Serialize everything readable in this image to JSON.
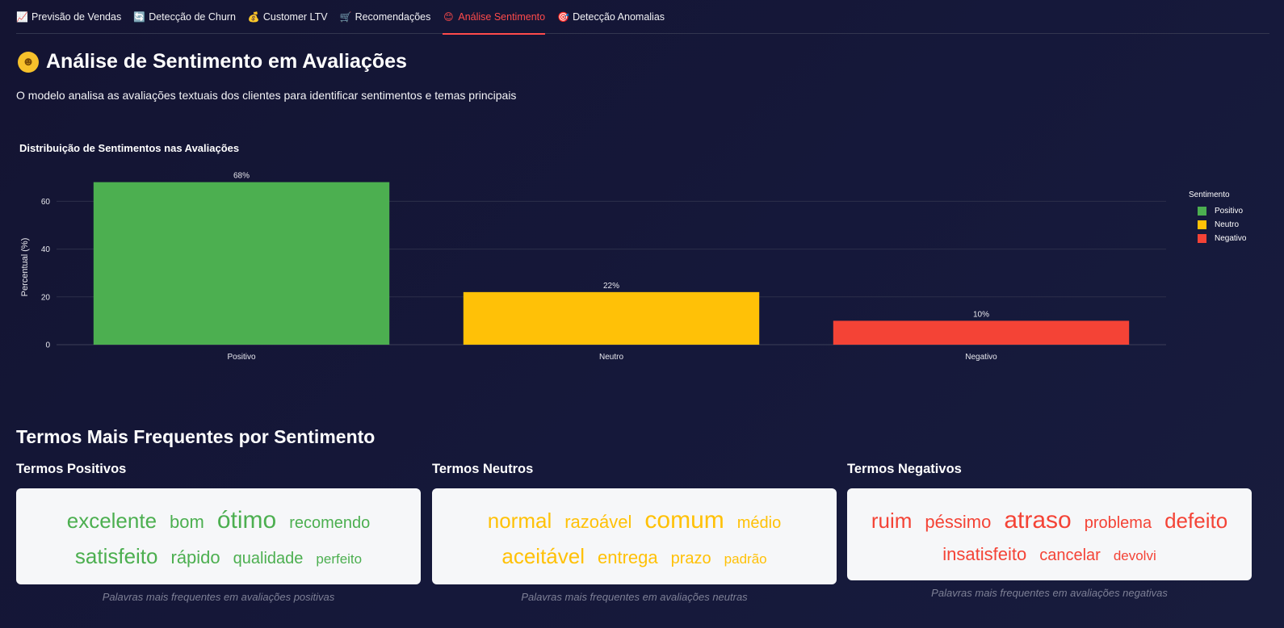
{
  "tabs": [
    {
      "icon": "📈",
      "label": "Previsão de Vendas",
      "active": false
    },
    {
      "icon": "🔄",
      "label": "Detecção de Churn",
      "active": false
    },
    {
      "icon": "💰",
      "label": "Customer LTV",
      "active": false
    },
    {
      "icon": "🛒",
      "label": "Recomendações",
      "active": false
    },
    {
      "icon": "😊",
      "label": "Análise Sentimento",
      "active": true
    },
    {
      "icon": "🎯",
      "label": "Detecção Anomalias",
      "active": false
    }
  ],
  "page": {
    "title": "Análise de Sentimento em Avaliações",
    "subtitle": "O modelo analisa as avaliações textuais dos clientes para identificar sentimentos e temas principais"
  },
  "chart_data": {
    "type": "bar",
    "title": "Distribuição de Sentimentos nas Avaliações",
    "categories": [
      "Positivo",
      "Neutro",
      "Negativo"
    ],
    "values": [
      68,
      22,
      10
    ],
    "data_labels": [
      "68%",
      "22%",
      "10%"
    ],
    "colors": [
      "#4caf50",
      "#ffc107",
      "#f44336"
    ],
    "xlabel": "",
    "ylabel": "Percentual (%)",
    "yticks": [
      0,
      20,
      40,
      60
    ],
    "ylim": [
      0,
      71.6
    ],
    "grid": true,
    "legend": {
      "title": "Sentimento",
      "placement": "right",
      "entries": [
        "Positivo",
        "Neutro",
        "Negativo"
      ]
    }
  },
  "terms": {
    "section_title": "Termos Mais Frequentes por Sentimento",
    "groups": [
      {
        "heading": "Termos Positivos",
        "color": "#4caf50",
        "caption": "Palavras mais frequentes em avaliações positivas",
        "words": [
          {
            "text": "excelente",
            "weight": 3
          },
          {
            "text": "bom",
            "weight": 2
          },
          {
            "text": "ótimo",
            "weight": 4
          },
          {
            "text": "recomendo",
            "weight": 1
          },
          {
            "text": "satisfeito",
            "weight": 3
          },
          {
            "text": "rápido",
            "weight": 2
          },
          {
            "text": "qualidade",
            "weight": 1
          },
          {
            "text": "perfeito",
            "weight": 0
          }
        ]
      },
      {
        "heading": "Termos Neutros",
        "color": "#ffc107",
        "caption": "Palavras mais frequentes em avaliações neutras",
        "words": [
          {
            "text": "normal",
            "weight": 3
          },
          {
            "text": "razoável",
            "weight": 2
          },
          {
            "text": "comum",
            "weight": 4
          },
          {
            "text": "médio",
            "weight": 1
          },
          {
            "text": "aceitável",
            "weight": 3
          },
          {
            "text": "entrega",
            "weight": 2
          },
          {
            "text": "prazo",
            "weight": 1
          },
          {
            "text": "padrão",
            "weight": 0
          }
        ]
      },
      {
        "heading": "Termos Negativos",
        "color": "#f44336",
        "caption": "Palavras mais frequentes em avaliações negativas",
        "words": [
          {
            "text": "ruim",
            "weight": 3
          },
          {
            "text": "péssimo",
            "weight": 2
          },
          {
            "text": "atraso",
            "weight": 4
          },
          {
            "text": "problema",
            "weight": 1
          },
          {
            "text": "defeito",
            "weight": 3
          },
          {
            "text": "insatisfeito",
            "weight": 2
          },
          {
            "text": "cancelar",
            "weight": 1
          },
          {
            "text": "devolvi",
            "weight": 0
          }
        ]
      }
    ]
  }
}
